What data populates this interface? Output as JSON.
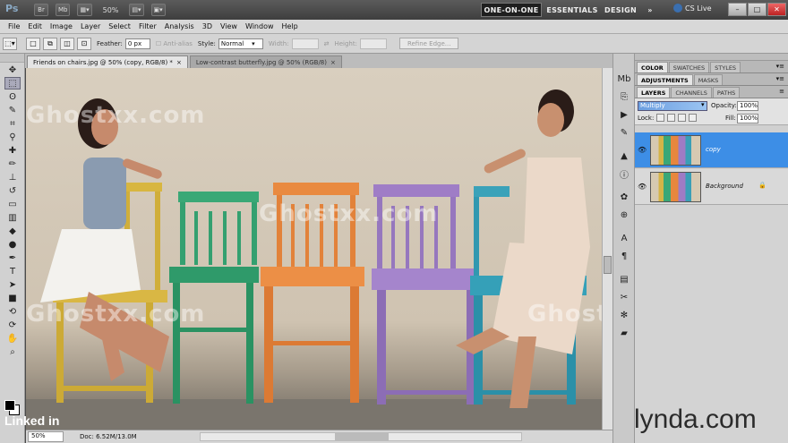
{
  "titlebar": {
    "app_logo": "Ps",
    "buttons": [
      "Br",
      "Mb"
    ],
    "zoom": "50%",
    "workspaces": [
      "ONE-ON-ONE",
      "ESSENTIALS",
      "DESIGN"
    ],
    "more": "»",
    "cs_live": "CS Live",
    "window_buttons": [
      "–",
      "□",
      "✕"
    ]
  },
  "menu": [
    "File",
    "Edit",
    "Image",
    "Layer",
    "Select",
    "Filter",
    "Analysis",
    "3D",
    "View",
    "Window",
    "Help"
  ],
  "options": {
    "feather_label": "Feather:",
    "feather_value": "0 px",
    "antialias_label": "Anti-alias",
    "style_label": "Style:",
    "style_value": "Normal",
    "width_label": "Width:",
    "height_label": "Height:",
    "refine_edge": "Refine Edge..."
  },
  "tabs": [
    {
      "label": "Friends on chairs.jpg @ 50% (copy, RGB/8) *",
      "close": "×"
    },
    {
      "label": "Low-contrast butterfly.jpg @ 50% (RGB/8)",
      "close": "×"
    }
  ],
  "status": {
    "zoom": "50%",
    "doc": "Doc: 6.52M/13.0M"
  },
  "watermarks": {
    "ghost": "Ghostxx.com",
    "linkedin": "Linked in",
    "lynda": "lynda.com"
  },
  "panels": {
    "group1_tabs": [
      "COLOR",
      "SWATCHES",
      "STYLES"
    ],
    "group2_tabs": [
      "ADJUSTMENTS",
      "MASKS"
    ],
    "group3_tabs": [
      "LAYERS",
      "CHANNELS",
      "PATHS"
    ],
    "blend_mode": "Multiply",
    "opacity_label": "Opacity:",
    "opacity_value": "100%",
    "lock_label": "Lock:",
    "fill_label": "Fill:",
    "fill_value": "100%",
    "layers": [
      {
        "name": "copy",
        "selected": true
      },
      {
        "name": "Background",
        "selected": false
      }
    ]
  }
}
